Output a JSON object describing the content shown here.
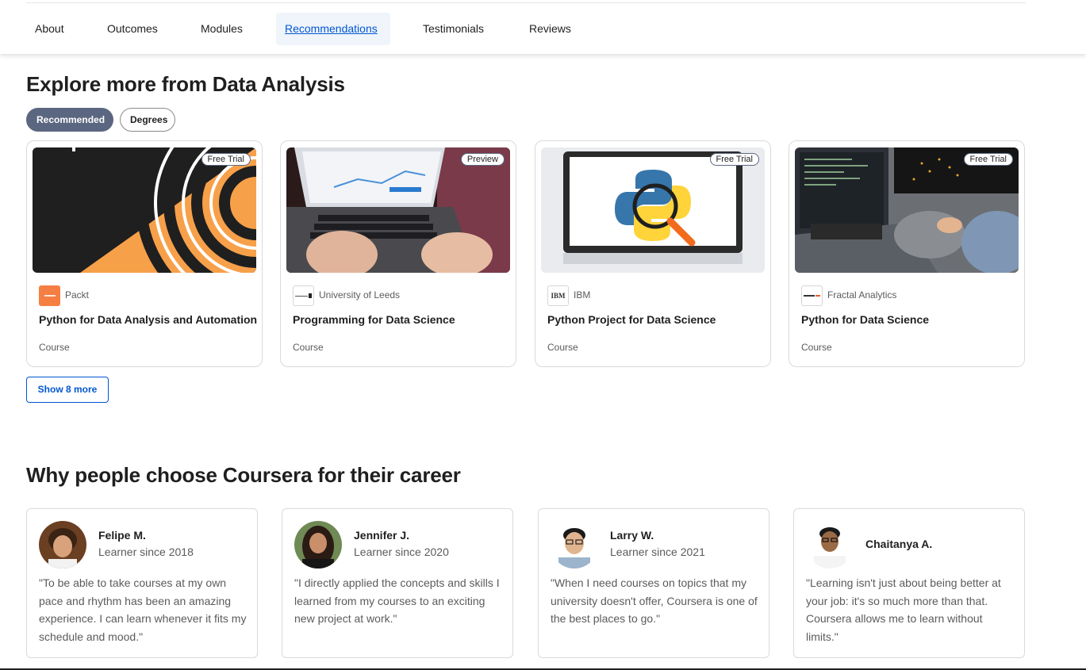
{
  "nav": {
    "tabs": [
      {
        "label": "About"
      },
      {
        "label": "Outcomes"
      },
      {
        "label": "Modules"
      },
      {
        "label": "Recommendations",
        "active": true
      },
      {
        "label": "Testimonials"
      },
      {
        "label": "Reviews"
      }
    ]
  },
  "explore": {
    "title": "Explore more from Data Analysis",
    "filters": [
      {
        "label": "Recommended",
        "active": true
      },
      {
        "label": "Degrees",
        "active": false
      }
    ],
    "courses": [
      {
        "badge": "Free Trial",
        "partner": "Packt",
        "title": "Python for Data Analysis and Automation",
        "type": "Course"
      },
      {
        "badge": "Preview",
        "partner": "University of Leeds",
        "title": "Programming for Data Science",
        "type": "Course"
      },
      {
        "badge": "Free Trial",
        "partner": "IBM",
        "title": "Python Project for Data Science",
        "type": "Course",
        "logo_text": "IBM"
      },
      {
        "badge": "Free Trial",
        "partner": "Fractal Analytics",
        "title": "Python for Data Science",
        "type": "Course"
      }
    ],
    "show_more": "Show 8 more"
  },
  "why": {
    "title": "Why people choose Coursera for their career",
    "testimonials": [
      {
        "name": "Felipe M.",
        "since": "Learner since 2018",
        "quote": "\"To be able to take courses at my own pace and rhythm has been an amazing experience. I can learn whenever it fits my schedule and mood.\""
      },
      {
        "name": "Jennifer J.",
        "since": "Learner since 2020",
        "quote": "\"I directly applied the concepts and skills I learned from my courses to an exciting new project at work.\""
      },
      {
        "name": "Larry W.",
        "since": "Learner since 2021",
        "quote": "\"When I need courses on topics that my university doesn't offer, Coursera is one of the best places to go.\""
      },
      {
        "name": "Chaitanya A.",
        "since": "",
        "quote": "\"Learning isn't just about being better at your job: it's so much more than that. Coursera allows me to learn without limits.\""
      }
    ]
  },
  "colors": {
    "accent": "#0056d2",
    "pill_active": "#5b6780",
    "packt_orange": "#f57e42",
    "python_blue": "#3776ab",
    "python_yellow": "#ffd43b"
  }
}
